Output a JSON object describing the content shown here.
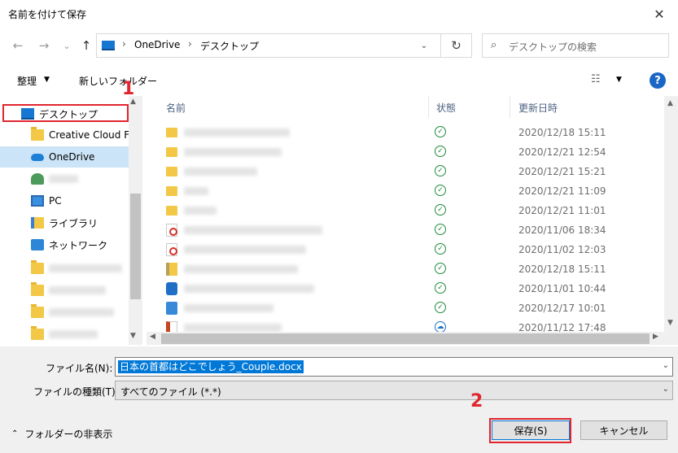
{
  "window": {
    "title": "名前を付けて保存",
    "close": "✕"
  },
  "nav": {
    "back": "←",
    "forward": "→",
    "recent": "⌄",
    "up": "↑",
    "refresh": "↻",
    "address": [
      "OneDrive",
      "デスクトップ"
    ],
    "address_sep": "›",
    "dropdown": "⌄",
    "search_placeholder": "デスクトップの検索"
  },
  "toolbar": {
    "organize": "整理",
    "organize_arrow": "▼",
    "new_folder": "新しいフォルダー",
    "view_icon": "☷",
    "view_arrow": "▼",
    "help": "?"
  },
  "sidebar": {
    "items": [
      {
        "label": "デスクトップ",
        "icon": "desktop-icon"
      },
      {
        "label": "Creative Cloud Files",
        "icon": "creative-cloud-folder-icon"
      },
      {
        "label": "OneDrive",
        "icon": "onedrive-cloud-icon"
      },
      {
        "label": "",
        "icon": "user-icon"
      },
      {
        "label": "PC",
        "icon": "pc-icon"
      },
      {
        "label": "ライブラリ",
        "icon": "library-icon"
      },
      {
        "label": "ネットワーク",
        "icon": "network-icon"
      },
      {
        "label": "",
        "icon": "folder-icon"
      },
      {
        "label": "",
        "icon": "folder-icon"
      },
      {
        "label": "",
        "icon": "folder-icon"
      },
      {
        "label": "",
        "icon": "folder-icon"
      }
    ]
  },
  "list": {
    "columns": [
      "名前",
      "状態",
      "更新日時"
    ],
    "rows": [
      {
        "icon": "folder-icon",
        "status": "synced",
        "date": "2020/12/18 15:11"
      },
      {
        "icon": "folder-icon",
        "status": "synced",
        "date": "2020/12/21 12:54"
      },
      {
        "icon": "folder-icon",
        "status": "synced",
        "date": "2020/12/21 15:21"
      },
      {
        "icon": "folder-icon",
        "status": "synced",
        "date": "2020/12/21 11:09"
      },
      {
        "icon": "folder-icon",
        "status": "synced",
        "date": "2020/12/21 11:01"
      },
      {
        "icon": "pdf-icon",
        "status": "synced",
        "date": "2020/11/06 18:34"
      },
      {
        "icon": "pdf-icon",
        "status": "synced",
        "date": "2020/11/02 12:03"
      },
      {
        "icon": "zip-icon",
        "status": "synced",
        "date": "2020/12/18 15:11"
      },
      {
        "icon": "ie-shortcut-icon",
        "status": "synced",
        "date": "2020/11/01 10:44"
      },
      {
        "icon": "app-icon",
        "status": "synced",
        "date": "2020/12/17 10:01"
      },
      {
        "icon": "ppt-icon",
        "status": "cloud",
        "date": "2020/11/12 17:48"
      }
    ],
    "check_glyph": "✓",
    "cloud_glyph": "☁"
  },
  "bottom": {
    "filename_label": "ファイル名(N):",
    "filename_value": "日本の首都はどこでしょう_Couple.docx",
    "filetype_label": "ファイルの種類(T):",
    "filetype_value": "すべてのファイル (*.*)",
    "hide_folders": "フォルダーの非表示",
    "save": "保存(S)",
    "cancel": "キャンセル"
  },
  "annotations": {
    "mark1": "1",
    "mark2": "2",
    "color": "#e0262f"
  },
  "colors": {
    "accent": "#0078d7",
    "selected_bg": "#cce4f7",
    "synced": "#1e8a3a"
  }
}
